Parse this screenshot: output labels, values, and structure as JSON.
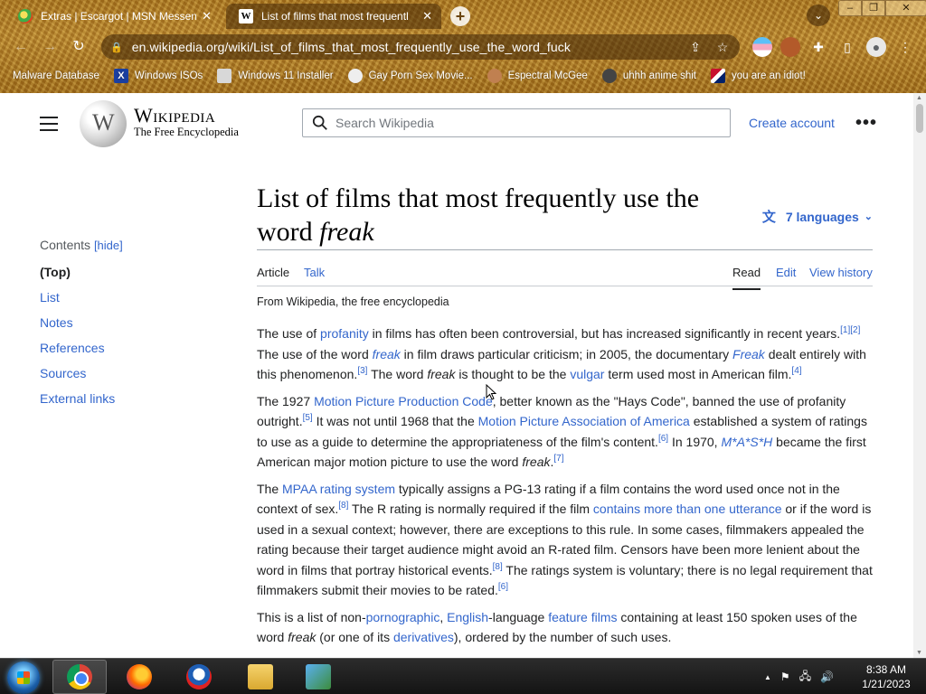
{
  "browser": {
    "tabs": [
      {
        "title": "Extras | Escargot | MSN Messen",
        "close": "✕",
        "active": false
      },
      {
        "title": "List of films that most frequentl",
        "close": "✕",
        "active": true
      }
    ],
    "new_tab": "+",
    "tab_search": "⌄",
    "window_controls": {
      "minimize": "–",
      "maximize": "❐",
      "close": "✕"
    },
    "url": "en.wikipedia.org/wiki/List_of_films_that_most_frequently_use_the_word_fuck",
    "nav": {
      "back": "←",
      "forward": "→",
      "reload": "↻"
    },
    "bookmarks": [
      {
        "label": "Malware Database",
        "icon": ""
      },
      {
        "label": "Windows ISOs",
        "icon": "X"
      },
      {
        "label": "Windows 11 Installer",
        "icon": ""
      },
      {
        "label": "Gay Porn Sex Movie...",
        "icon": ""
      },
      {
        "label": "Espectral McGee",
        "icon": ""
      },
      {
        "label": "uhhh anime shit",
        "icon": ""
      },
      {
        "label": "you are an idiot!",
        "icon": ""
      }
    ]
  },
  "wiki": {
    "wordmark_title": "Wikipedia",
    "wordmark_tagline": "The Free Encyclopedia",
    "search_placeholder": "Search Wikipedia",
    "create_account": "Create account",
    "more": "•••",
    "toc": {
      "heading": "Contents",
      "hide": "[hide]",
      "items": [
        "(Top)",
        "List",
        "Notes",
        "References",
        "Sources",
        "External links"
      ]
    },
    "title_main": "List of films that most frequently use the word ",
    "title_em": "freak",
    "languages": "7 languages",
    "tabs": {
      "article": "Article",
      "talk": "Talk",
      "read": "Read",
      "edit": "Edit",
      "history": "View history"
    },
    "from": "From Wikipedia, the free encyclopedia",
    "p1": {
      "t1": "The use of ",
      "l1": "profanity",
      "t2": " in films has often been controversial, but has increased significantly in recent years.",
      "s1": "[1][2]",
      "t3": " The use of the word ",
      "i1": "freak",
      "t4": " in film draws particular criticism; in 2005, the documentary ",
      "l2": "Freak",
      "t5": " dealt entirely with this phenomenon.",
      "s2": "[3]",
      "t6": " The word ",
      "i2": "freak",
      "t7": " is thought to be the ",
      "l3": "vulgar",
      "t8": " term used most in American film.",
      "s3": "[4]"
    },
    "p2": {
      "t1": "The 1927 ",
      "l1": "Motion Picture Production Code",
      "t2": ", better known as the \"Hays Code\", banned the use of profanity outright.",
      "s1": "[5]",
      "t3": " It was not until 1968 that the ",
      "l2": "Motion Picture Association of America",
      "t4": " established a system of ratings to use as a guide to determine the appropriateness of the film's content.",
      "s2": "[6]",
      "t5": " In 1970, ",
      "l3": "M*A*S*H",
      "t6": " became the first American major motion picture to use the word ",
      "i1": "freak",
      "t7": ".",
      "s3": "[7]"
    },
    "p3": {
      "t1": "The ",
      "l1": "MPAA rating system",
      "t2": " typically assigns a PG-13 rating if a film contains the word used once not in the context of sex.",
      "s1": "[8]",
      "t3": " The R rating is normally required if the film ",
      "l2": "contains more than one utterance",
      "t4": " or if the word is used in a sexual context; however, there are exceptions to this rule. In some cases, filmmakers appealed the rating because their target audience might avoid an R-rated film. Censors have been more lenient about the word in films that portray historical events.",
      "s2": "[8]",
      "t5": " The ratings system is voluntary; there is no legal requirement that filmmakers submit their movies to be rated.",
      "s3": "[6]"
    },
    "p4": {
      "t1": "This is a list of non-",
      "l1": "pornographic",
      "t2": ", ",
      "l2": "English",
      "t3": "-language ",
      "l3": "feature films",
      "t4": " containing at least 150 spoken uses of the word ",
      "i1": "freak",
      "t5": " (or one of its ",
      "l4": "derivatives",
      "t6": "), ordered by the number of such uses."
    }
  },
  "taskbar": {
    "time": "8:38 AM",
    "date": "1/21/2023",
    "tray_icons": [
      "▲",
      "⚑",
      "🖧",
      "🔊"
    ]
  },
  "colors": {
    "link": "#3366cc",
    "text": "#202122",
    "chrome": "#a8741e"
  }
}
